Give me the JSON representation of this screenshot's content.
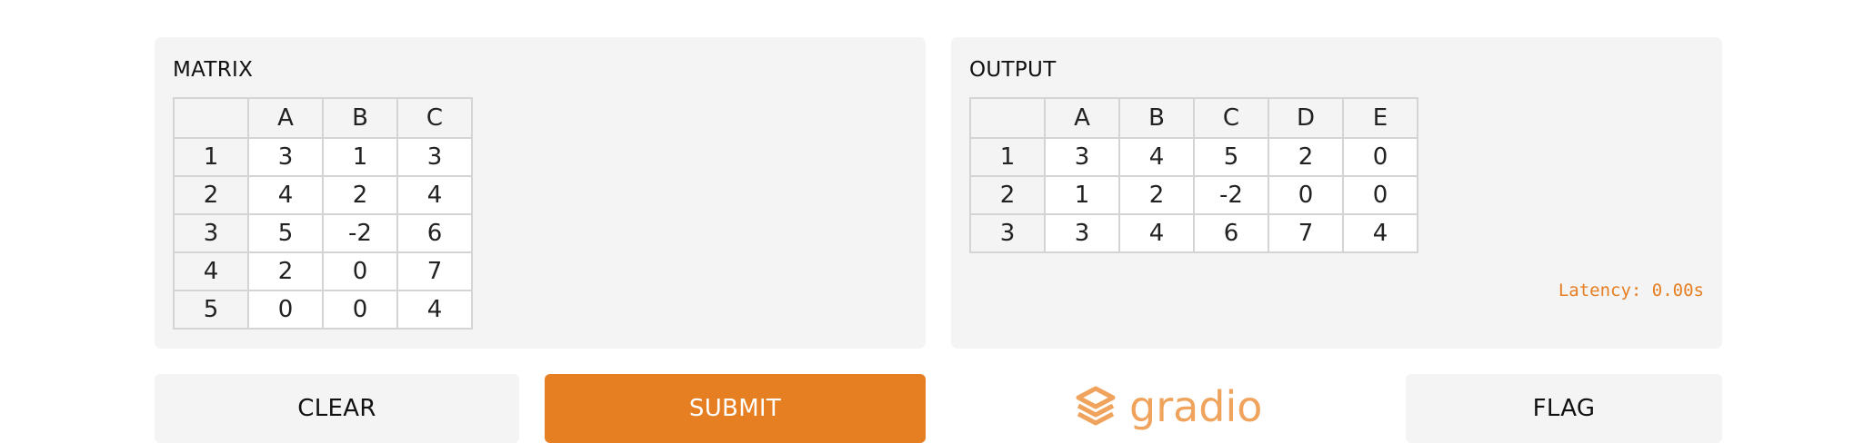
{
  "input": {
    "label": "MATRIX",
    "columns": [
      "A",
      "B",
      "C"
    ],
    "rows": [
      {
        "index": "1",
        "cells": [
          "3",
          "1",
          "3"
        ]
      },
      {
        "index": "2",
        "cells": [
          "4",
          "2",
          "4"
        ]
      },
      {
        "index": "3",
        "cells": [
          "5",
          "-2",
          "6"
        ]
      },
      {
        "index": "4",
        "cells": [
          "2",
          "0",
          "7"
        ]
      },
      {
        "index": "5",
        "cells": [
          "0",
          "0",
          "4"
        ]
      }
    ]
  },
  "output": {
    "label": "OUTPUT",
    "columns": [
      "A",
      "B",
      "C",
      "D",
      "E"
    ],
    "rows": [
      {
        "index": "1",
        "cells": [
          "3",
          "4",
          "5",
          "2",
          "0"
        ]
      },
      {
        "index": "2",
        "cells": [
          "1",
          "2",
          "-2",
          "0",
          "0"
        ]
      },
      {
        "index": "3",
        "cells": [
          "3",
          "4",
          "6",
          "7",
          "4"
        ]
      }
    ],
    "latency": "Latency: 0.00s"
  },
  "buttons": {
    "clear": "CLEAR",
    "submit": "SUBMIT",
    "flag": "FLAG"
  },
  "brand": {
    "name": "gradio",
    "icon": "gradio-logo-icon"
  },
  "colors": {
    "accent": "#e67e22",
    "brand": "#f0a35c",
    "panel": "#f4f4f4"
  }
}
